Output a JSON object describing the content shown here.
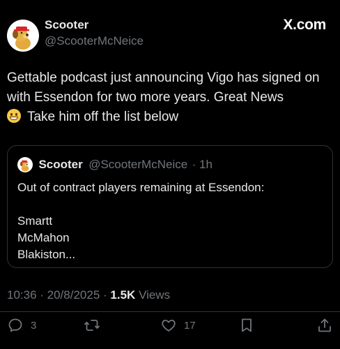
{
  "header": {
    "display_name": "Scooter",
    "handle": "@ScooterMcNeice",
    "brand": "X.com"
  },
  "tweet": {
    "text_line1": "Gettable podcast just announcing Vigo has signed on with Essendon for two more years. Great News",
    "text_line2": "Take him off the list below",
    "emoji": "grinning-face"
  },
  "quote": {
    "display_name": "Scooter",
    "handle": "@ScooterMcNeice",
    "time": "· 1h",
    "lines": [
      "Out of contract players remaining at Essendon:",
      "",
      "Smartt",
      "McMahon",
      "Blakiston..."
    ]
  },
  "meta": {
    "time": "10:36 · 20/8/2025 ·",
    "views_count": "1.5K",
    "views_label": "Views"
  },
  "actions": {
    "reply_count": "3",
    "like_count": "17",
    "icons": [
      "reply-icon",
      "retweet-icon",
      "like-icon",
      "bookmark-icon",
      "share-icon"
    ]
  }
}
